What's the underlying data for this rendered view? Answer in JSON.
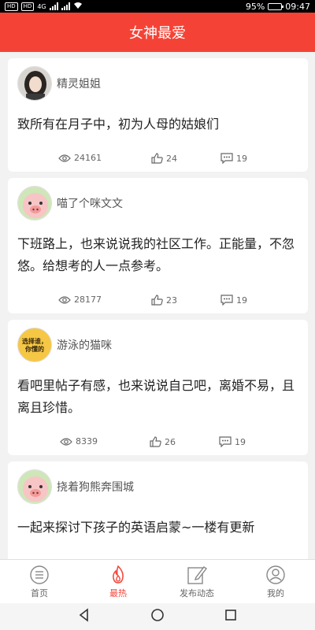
{
  "status_bar": {
    "left_badges": [
      "HD",
      "HD"
    ],
    "network": "4G",
    "battery": "95%",
    "battery_level": 0.95,
    "time": "09:47"
  },
  "header": {
    "title": "女神最爱"
  },
  "posts": [
    {
      "user": "精灵姐姐",
      "avatar_icon": "woman-photo-avatar-icon",
      "text": "致所有在月子中，初为人母的姑娘们",
      "views": "24161",
      "likes": "24",
      "comments": "19"
    },
    {
      "user": "喵了个咪文文",
      "avatar_icon": "cartoon-pig-avatar-icon",
      "text": "下班路上，也来说说我的社区工作。正能量，不忽悠。给想考的人一点参考。",
      "views": "28177",
      "likes": "23",
      "comments": "19"
    },
    {
      "user": "游泳的猫咪",
      "avatar_icon": "text-badge-avatar-icon",
      "avatar_text": "选择谁，你懂的",
      "text": "看吧里帖子有感，也来说说自己吧，离婚不易，且离且珍惜。",
      "views": "8339",
      "likes": "26",
      "comments": "19"
    },
    {
      "user": "挠着狗熊奔围城",
      "avatar_icon": "cartoon-pig-avatar-icon",
      "text": "一起来探讨下孩子的英语启蒙~一楼有更新"
    }
  ],
  "tabs": [
    {
      "label": "首页",
      "icon": "home-list-icon",
      "active": false
    },
    {
      "label": "最热",
      "icon": "flame-icon",
      "active": true
    },
    {
      "label": "发布动态",
      "icon": "edit-post-icon",
      "active": false
    },
    {
      "label": "我的",
      "icon": "user-profile-icon",
      "active": false
    }
  ],
  "colors": {
    "brand": "#f44336",
    "background": "#f2f2f2"
  }
}
